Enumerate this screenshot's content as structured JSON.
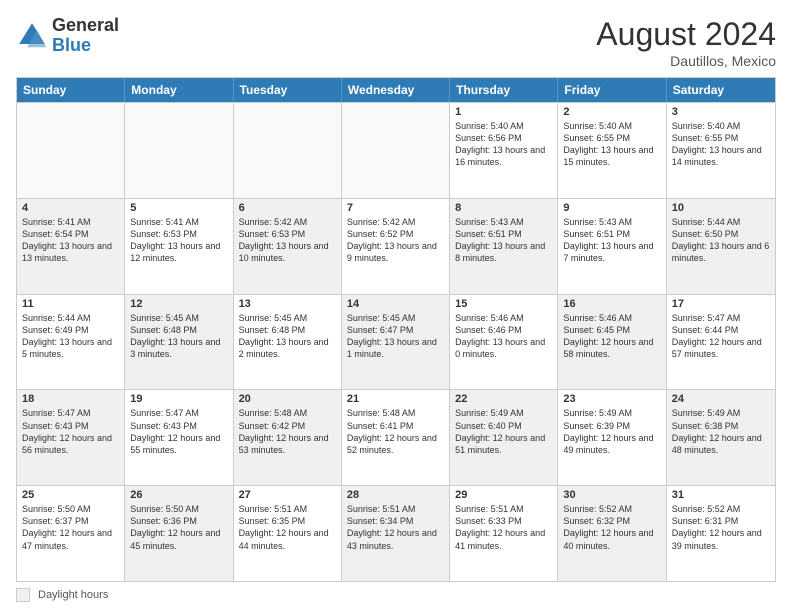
{
  "header": {
    "logo_general": "General",
    "logo_blue": "Blue",
    "main_title": "August 2024",
    "subtitle": "Dautillos, Mexico"
  },
  "calendar": {
    "days_of_week": [
      "Sunday",
      "Monday",
      "Tuesday",
      "Wednesday",
      "Thursday",
      "Friday",
      "Saturday"
    ],
    "weeks": [
      [
        {
          "day": "",
          "info": "",
          "empty": true
        },
        {
          "day": "",
          "info": "",
          "empty": true
        },
        {
          "day": "",
          "info": "",
          "empty": true
        },
        {
          "day": "",
          "info": "",
          "empty": true
        },
        {
          "day": "1",
          "info": "Sunrise: 5:40 AM\nSunset: 6:56 PM\nDaylight: 13 hours\nand 16 minutes."
        },
        {
          "day": "2",
          "info": "Sunrise: 5:40 AM\nSunset: 6:55 PM\nDaylight: 13 hours\nand 15 minutes."
        },
        {
          "day": "3",
          "info": "Sunrise: 5:40 AM\nSunset: 6:55 PM\nDaylight: 13 hours\nand 14 minutes."
        }
      ],
      [
        {
          "day": "4",
          "info": "Sunrise: 5:41 AM\nSunset: 6:54 PM\nDaylight: 13 hours\nand 13 minutes.",
          "shaded": true
        },
        {
          "day": "5",
          "info": "Sunrise: 5:41 AM\nSunset: 6:53 PM\nDaylight: 13 hours\nand 12 minutes."
        },
        {
          "day": "6",
          "info": "Sunrise: 5:42 AM\nSunset: 6:53 PM\nDaylight: 13 hours\nand 10 minutes.",
          "shaded": true
        },
        {
          "day": "7",
          "info": "Sunrise: 5:42 AM\nSunset: 6:52 PM\nDaylight: 13 hours\nand 9 minutes."
        },
        {
          "day": "8",
          "info": "Sunrise: 5:43 AM\nSunset: 6:51 PM\nDaylight: 13 hours\nand 8 minutes.",
          "shaded": true
        },
        {
          "day": "9",
          "info": "Sunrise: 5:43 AM\nSunset: 6:51 PM\nDaylight: 13 hours\nand 7 minutes."
        },
        {
          "day": "10",
          "info": "Sunrise: 5:44 AM\nSunset: 6:50 PM\nDaylight: 13 hours\nand 6 minutes.",
          "shaded": true
        }
      ],
      [
        {
          "day": "11",
          "info": "Sunrise: 5:44 AM\nSunset: 6:49 PM\nDaylight: 13 hours\nand 5 minutes."
        },
        {
          "day": "12",
          "info": "Sunrise: 5:45 AM\nSunset: 6:48 PM\nDaylight: 13 hours\nand 3 minutes.",
          "shaded": true
        },
        {
          "day": "13",
          "info": "Sunrise: 5:45 AM\nSunset: 6:48 PM\nDaylight: 13 hours\nand 2 minutes."
        },
        {
          "day": "14",
          "info": "Sunrise: 5:45 AM\nSunset: 6:47 PM\nDaylight: 13 hours\nand 1 minute.",
          "shaded": true
        },
        {
          "day": "15",
          "info": "Sunrise: 5:46 AM\nSunset: 6:46 PM\nDaylight: 13 hours\nand 0 minutes."
        },
        {
          "day": "16",
          "info": "Sunrise: 5:46 AM\nSunset: 6:45 PM\nDaylight: 12 hours\nand 58 minutes.",
          "shaded": true
        },
        {
          "day": "17",
          "info": "Sunrise: 5:47 AM\nSunset: 6:44 PM\nDaylight: 12 hours\nand 57 minutes."
        }
      ],
      [
        {
          "day": "18",
          "info": "Sunrise: 5:47 AM\nSunset: 6:43 PM\nDaylight: 12 hours\nand 56 minutes.",
          "shaded": true
        },
        {
          "day": "19",
          "info": "Sunrise: 5:47 AM\nSunset: 6:43 PM\nDaylight: 12 hours\nand 55 minutes."
        },
        {
          "day": "20",
          "info": "Sunrise: 5:48 AM\nSunset: 6:42 PM\nDaylight: 12 hours\nand 53 minutes.",
          "shaded": true
        },
        {
          "day": "21",
          "info": "Sunrise: 5:48 AM\nSunset: 6:41 PM\nDaylight: 12 hours\nand 52 minutes."
        },
        {
          "day": "22",
          "info": "Sunrise: 5:49 AM\nSunset: 6:40 PM\nDaylight: 12 hours\nand 51 minutes.",
          "shaded": true
        },
        {
          "day": "23",
          "info": "Sunrise: 5:49 AM\nSunset: 6:39 PM\nDaylight: 12 hours\nand 49 minutes."
        },
        {
          "day": "24",
          "info": "Sunrise: 5:49 AM\nSunset: 6:38 PM\nDaylight: 12 hours\nand 48 minutes.",
          "shaded": true
        }
      ],
      [
        {
          "day": "25",
          "info": "Sunrise: 5:50 AM\nSunset: 6:37 PM\nDaylight: 12 hours\nand 47 minutes."
        },
        {
          "day": "26",
          "info": "Sunrise: 5:50 AM\nSunset: 6:36 PM\nDaylight: 12 hours\nand 45 minutes.",
          "shaded": true
        },
        {
          "day": "27",
          "info": "Sunrise: 5:51 AM\nSunset: 6:35 PM\nDaylight: 12 hours\nand 44 minutes."
        },
        {
          "day": "28",
          "info": "Sunrise: 5:51 AM\nSunset: 6:34 PM\nDaylight: 12 hours\nand 43 minutes.",
          "shaded": true
        },
        {
          "day": "29",
          "info": "Sunrise: 5:51 AM\nSunset: 6:33 PM\nDaylight: 12 hours\nand 41 minutes."
        },
        {
          "day": "30",
          "info": "Sunrise: 5:52 AM\nSunset: 6:32 PM\nDaylight: 12 hours\nand 40 minutes.",
          "shaded": true
        },
        {
          "day": "31",
          "info": "Sunrise: 5:52 AM\nSunset: 6:31 PM\nDaylight: 12 hours\nand 39 minutes."
        }
      ]
    ]
  },
  "legend": {
    "shaded_label": "Daylight hours"
  }
}
